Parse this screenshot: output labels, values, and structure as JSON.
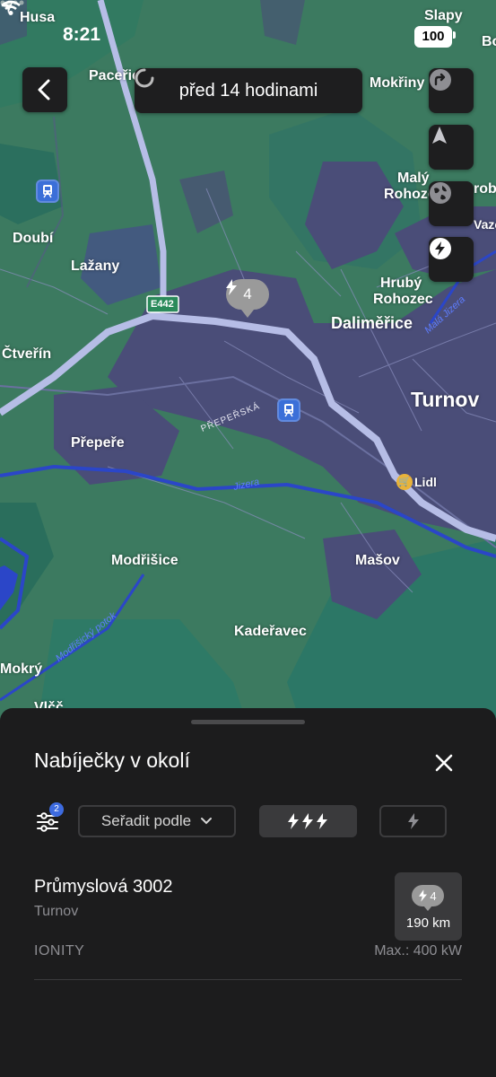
{
  "status_bar": {
    "time": "8:21",
    "battery": "100"
  },
  "map": {
    "timestamp": "před 14 hodinami",
    "pin_count": "4",
    "road_shield": "E442",
    "road_name": "PŘEPEŘSKÁ",
    "labels": {
      "husa": "Husa",
      "slapy": "Slapy",
      "bo": "Bo",
      "pacerice": "Paceřice",
      "mokriny": "Mokřiny",
      "maly_rohozec_1": "Malý",
      "maly_rohozec_2": "Rohozec",
      "roby": "roby",
      "vazove": "Vazove",
      "doubi": "Doubí",
      "lazany": "Lažany",
      "hruby_rohozec_1": "Hrubý",
      "hruby_rohozec_2": "Rohozec",
      "dalimerice": "Daliměřice",
      "ctverin": "Čtveřín",
      "turnov": "Turnov",
      "prepere": "Přepeře",
      "lidl": "Lidl",
      "modrisice": "Modřišice",
      "masov": "Mašov",
      "kaderavec": "Kadeřavec",
      "mokry": "Mokrý",
      "vlcc": "Vlčč"
    },
    "rivers": {
      "jizera": "Jizera",
      "mala_jizera": "Malá Jizera",
      "modrisicky": "Modřišický potok"
    },
    "colors": {
      "forest": "#3c7a60",
      "urban": "#4a4d78",
      "road": "#b6bde6",
      "water": "#2b46c8"
    }
  },
  "sheet": {
    "title": "Nabíječky v okolí",
    "filter_badge": "2",
    "sort_label": "Seřadit podle",
    "station": {
      "name": "Průmyslová 3002",
      "city": "Turnov",
      "operator": "IONITY",
      "max_power": "Max.: 400 kW",
      "stall_count": "4",
      "distance": "190 km"
    }
  }
}
